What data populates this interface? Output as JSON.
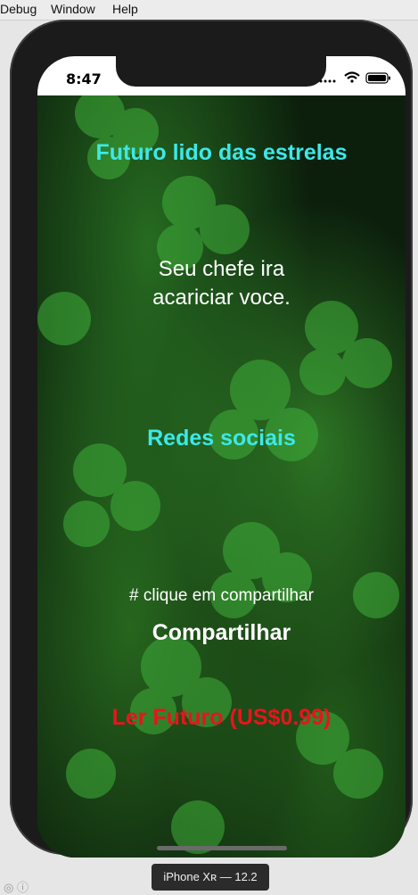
{
  "menubar": {
    "items": [
      "Debug",
      "Window",
      "Help"
    ]
  },
  "simulator": {
    "device_label": "iPhone Xʀ — 12.2"
  },
  "statusbar": {
    "time": "8:47",
    "icons": [
      "signal-icon",
      "wifi-icon",
      "battery-icon"
    ]
  },
  "app": {
    "title": "Futuro lido das estrelas",
    "message_line1": "Seu chefe ira",
    "message_line2": "acariciar voce.",
    "social_heading": "Redes sociais",
    "share_hint": "# clique em compartilhar",
    "share_button": "Compartilhar",
    "read_button": "Ler Futuro (US$0.99)"
  },
  "colors": {
    "accent_cyan": "#3de8e8",
    "purchase_red": "#e8141c",
    "text_white": "#ffffff"
  }
}
